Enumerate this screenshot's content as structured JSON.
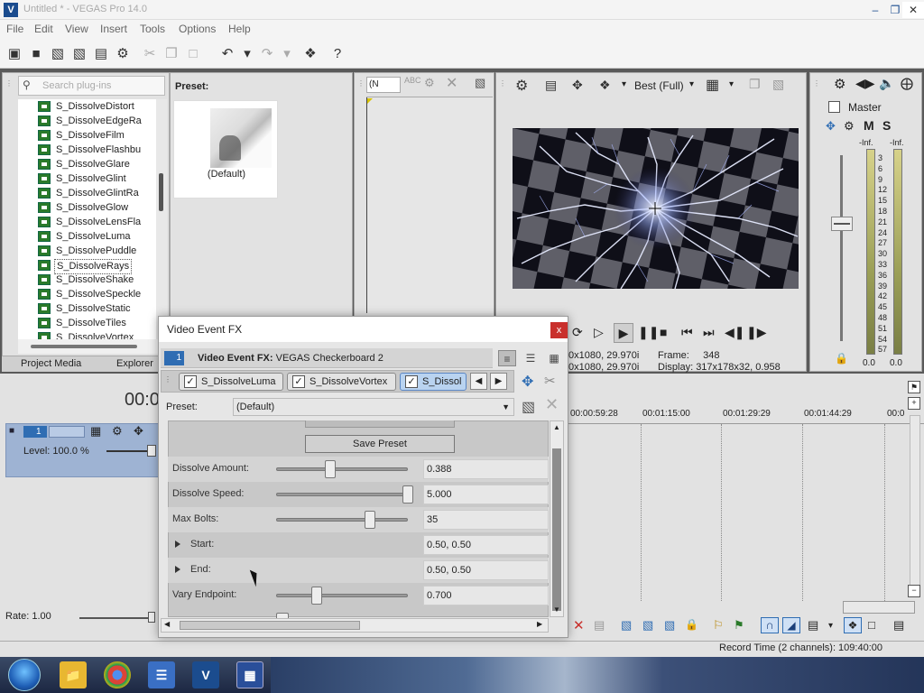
{
  "window": {
    "title": "Untitled * - VEGAS Pro 14.0",
    "icon": "V"
  },
  "menu": [
    "File",
    "Edit",
    "View",
    "Insert",
    "Tools",
    "Options",
    "Help"
  ],
  "explorer": {
    "search_placeholder": "Search plug-ins",
    "plugins": [
      "S_DissolveDistort",
      "S_DissolveEdgeRa",
      "S_DissolveFilm",
      "S_DissolveFlashbu",
      "S_DissolveGlare",
      "S_DissolveGlint",
      "S_DissolveGlintRa",
      "S_DissolveGlow",
      "S_DissolveLensFla",
      "S_DissolveLuma",
      "S_DissolvePuddle",
      "S_DissolveRays",
      "S_DissolveShake",
      "S_DissolveSpeckle",
      "S_DissolveStatic",
      "S_DissolveTiles",
      "S_DissolveVortex"
    ],
    "selected": "S_DissolveRays",
    "tabs": [
      "Project Media",
      "Explorer"
    ]
  },
  "preset_panel": {
    "label": "Preset:",
    "default_name": "(Default)"
  },
  "trimmer": {
    "combo": "(N"
  },
  "preview": {
    "quality": "Best (Full)",
    "project_info": "0x1080, 29.970i",
    "preview_info": "0x1080, 29.970i",
    "frame_label": "Frame:",
    "frame": "348",
    "display_label": "Display:",
    "display": "317x178x32, 0.958"
  },
  "master": {
    "label": "Master",
    "inf_left": "-Inf.",
    "inf_right": "-Inf.",
    "scale": [
      "3",
      "6",
      "9",
      "12",
      "15",
      "18",
      "21",
      "24",
      "27",
      "30",
      "33",
      "36",
      "39",
      "42",
      "45",
      "48",
      "51",
      "54",
      "57"
    ],
    "value_left": "0.0",
    "value_right": "0.0"
  },
  "timeline": {
    "time": "00:0",
    "track_number": "1",
    "level": "Level: 100.0 %",
    "ruler": [
      "00:00:59:28",
      "00:01:15:00",
      "00:01:29:29",
      "00:01:44:29",
      "00:0"
    ],
    "rate": "Rate: 1.00"
  },
  "status": {
    "record_time": "Record Time (2 channels): 109:40:00"
  },
  "dialog": {
    "title": "Video Event FX",
    "close": "x",
    "chip": "1",
    "head_label": "Video Event FX:",
    "head_value": "VEGAS Checkerboard 2",
    "chain": [
      "S_DissolveLuma",
      "S_DissolveVortex",
      "S_Dissol"
    ],
    "preset_label": "Preset:",
    "preset_value": "(Default)",
    "save_preset": "Save Preset",
    "params": [
      {
        "name": "Dissolve Amount:",
        "value": "0.388",
        "slider": 0.388,
        "expand": false
      },
      {
        "name": "Dissolve Speed:",
        "value": "5.000",
        "slider": 1.0,
        "expand": false
      },
      {
        "name": "Max Bolts:",
        "value": "35",
        "slider": 0.7,
        "expand": false
      },
      {
        "name": "Start:",
        "value": "0.50, 0.50",
        "expand": true
      },
      {
        "name": "End:",
        "value": "0.50, 0.50",
        "expand": true
      },
      {
        "name": "Vary Endpoint:",
        "value": "0.700",
        "slider": 0.28,
        "expand": false
      }
    ]
  },
  "colors": {
    "accent": "#2f6db3",
    "track": "#9eb3d3",
    "close": "#c9302c"
  }
}
